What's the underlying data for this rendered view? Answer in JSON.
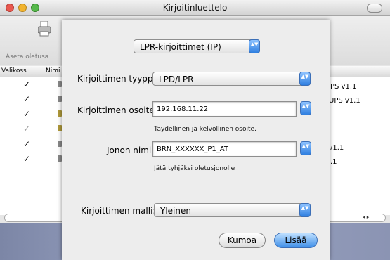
{
  "window": {
    "title": "Kirjoitinluettelo",
    "toolbar": {
      "default_label": "Aseta oletusa"
    },
    "columns": [
      "Valikoss",
      "Nimi"
    ],
    "rows": [
      {
        "checked": true,
        "dim": false,
        "right_text": "PS v1.1"
      },
      {
        "checked": true,
        "dim": false,
        "right_text": "UPS v1.1"
      },
      {
        "checked": true,
        "dim": false,
        "right_text": ""
      },
      {
        "checked": true,
        "dim": true,
        "right_text": ""
      },
      {
        "checked": true,
        "dim": false,
        "right_text": "/1.1"
      },
      {
        "checked": true,
        "dim": false,
        "right_text": ".1"
      }
    ]
  },
  "sheet": {
    "connection_popup": "LPR-kirjoittimet (IP)",
    "printer_type": {
      "label": "Kirjoittimen tyyppi:",
      "value": "LPD/LPR"
    },
    "printer_address": {
      "label": "Kirjoittimen osoite:",
      "value": "192.168.11.22",
      "hint": "Täydellinen ja kelvollinen osoite."
    },
    "queue_name": {
      "label": "Jonon nimi:",
      "value": "BRN_XXXXXX_P1_AT",
      "hint": "Jätä tyhjäksi oletusjonolle"
    },
    "printer_model": {
      "label": "Kirjoittimen malli:",
      "value": "Yleinen"
    },
    "buttons": {
      "cancel": "Kumoa",
      "add": "Lisää"
    }
  },
  "colors": {
    "accent": "#3f8fe8",
    "close": "#e8584f",
    "minimize": "#f1b32e",
    "zoom": "#55b84a"
  },
  "icons": {
    "updown_arrows": "▲▼",
    "check_mark": "✓",
    "scroll_left": "◂",
    "scroll_right": "▸"
  }
}
